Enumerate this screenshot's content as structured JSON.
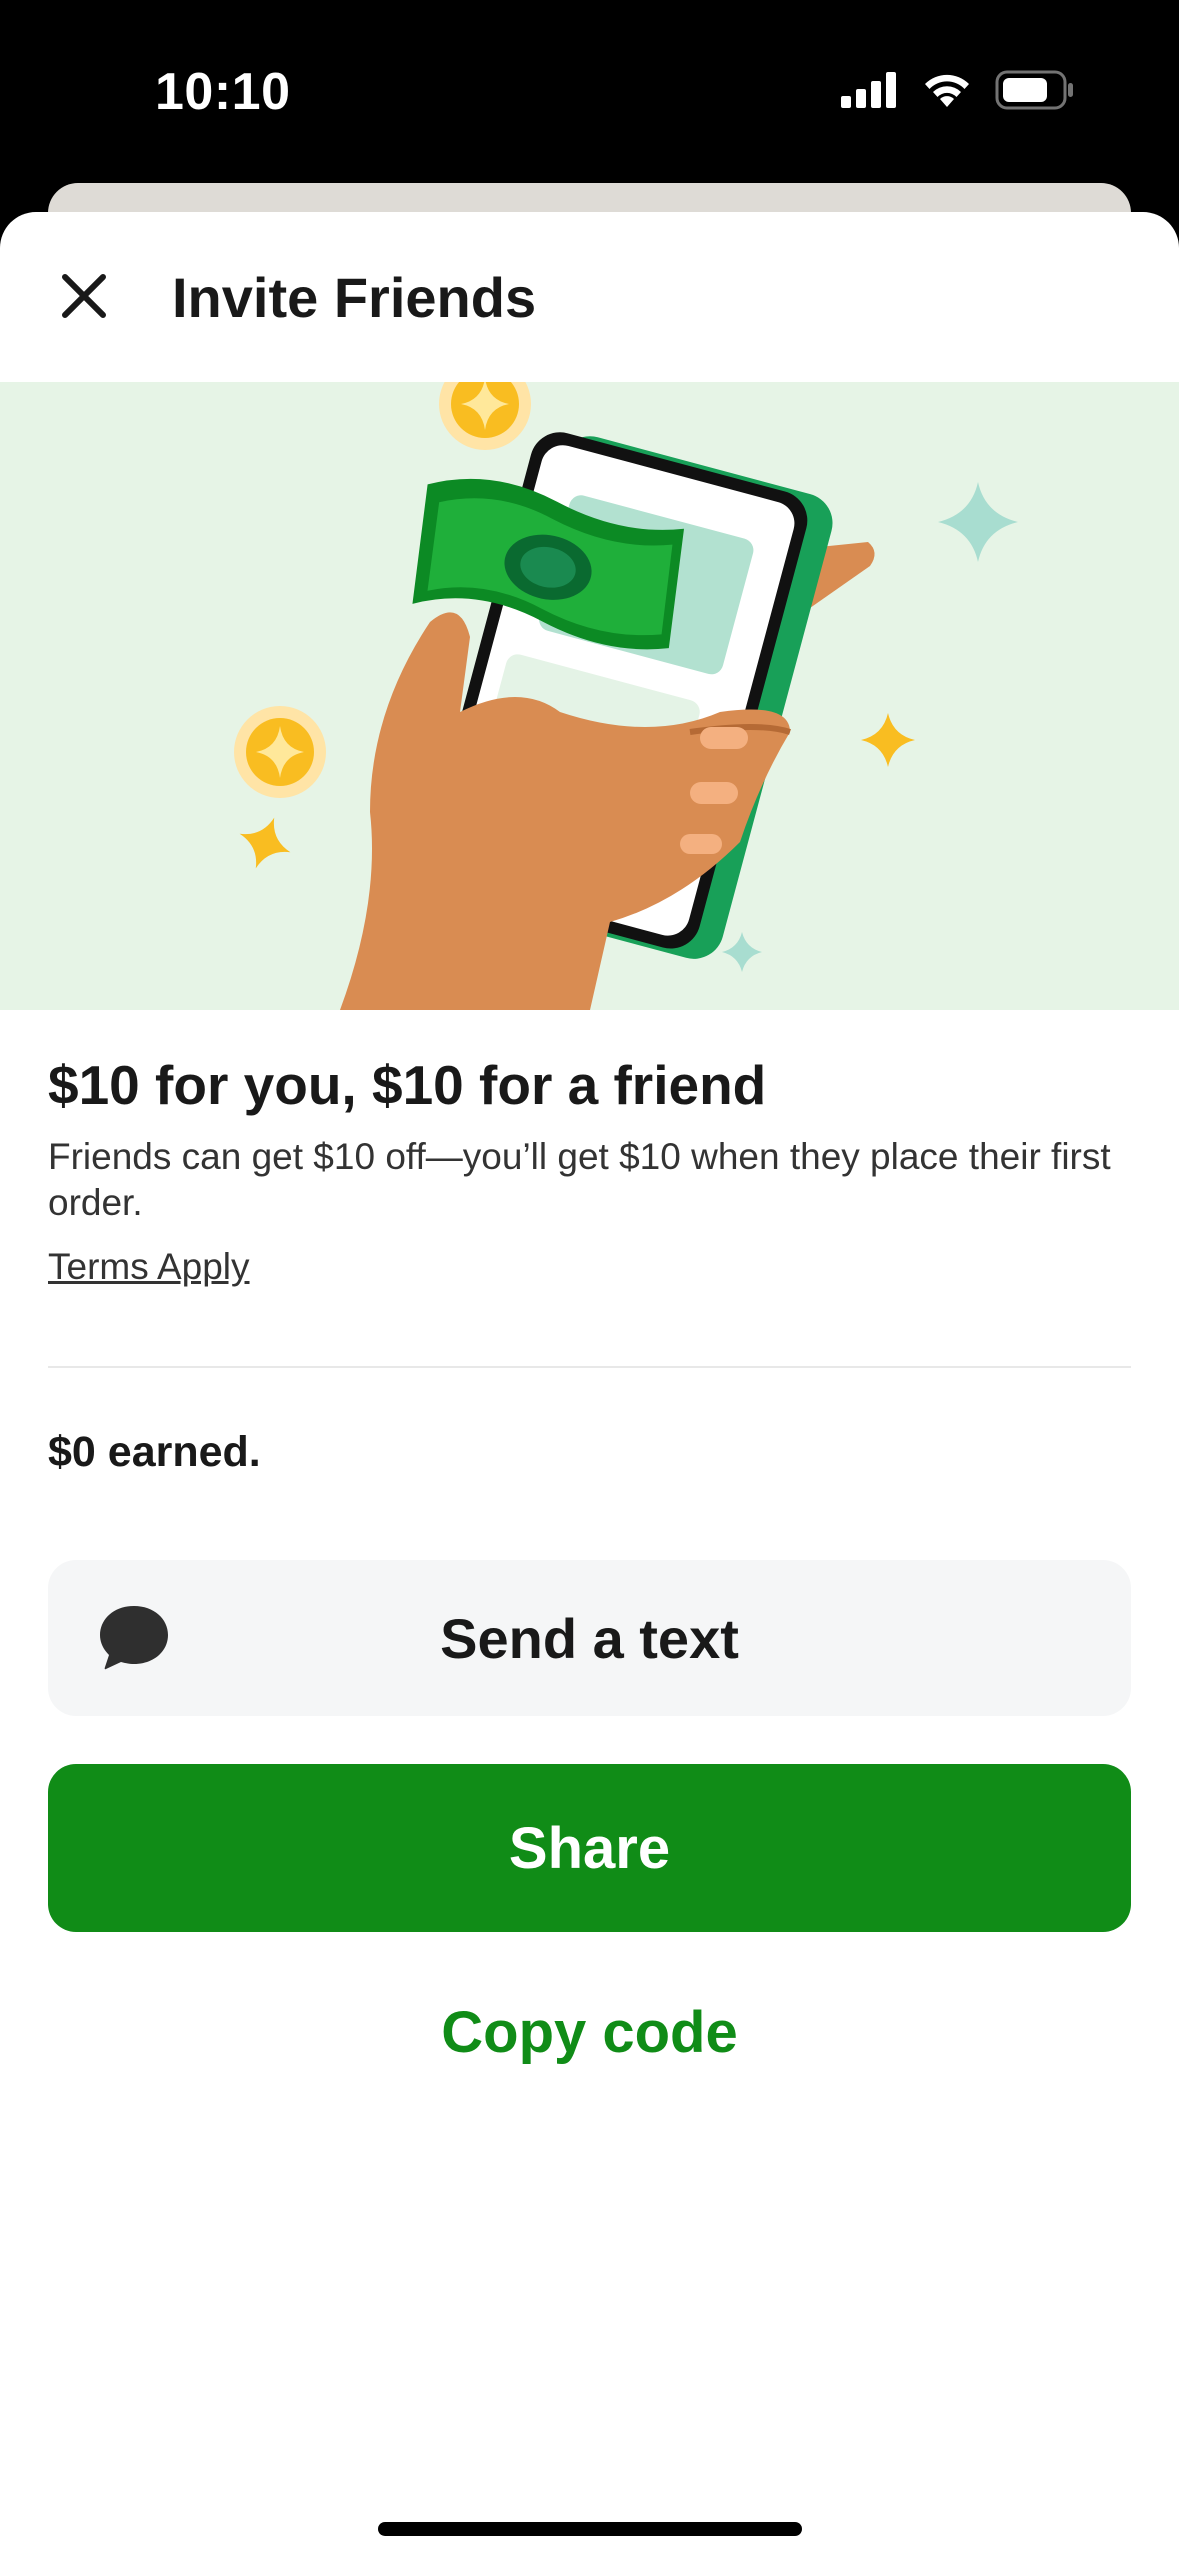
{
  "status_bar": {
    "time": "10:10"
  },
  "header": {
    "title": "Invite Friends"
  },
  "promo": {
    "title": "$10 for you, $10 for a friend",
    "description": "Friends can get $10 off—you’ll get $10 when they place their first order.",
    "terms_label": "Terms Apply"
  },
  "earned": {
    "text": "$0 earned."
  },
  "actions": {
    "send_text_label": "Send a text",
    "share_label": "Share",
    "copy_code_label": "Copy code"
  },
  "colors": {
    "brand_green": "#108c17",
    "hero_background": "#e6f4e6",
    "secondary_button": "#f5f6f7"
  },
  "icons": {
    "close": "close-icon",
    "message": "message-bubble-icon",
    "signal": "cellular-signal-icon",
    "wifi": "wifi-icon",
    "battery": "battery-icon"
  }
}
